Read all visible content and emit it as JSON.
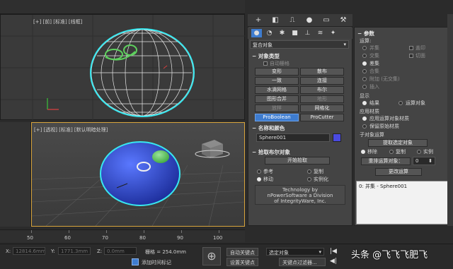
{
  "viewports": {
    "top": {
      "label": "[+] [前] [标准] [线框]"
    },
    "perspective": {
      "label": "[+] [透视] [标准] [默认明暗处理]"
    }
  },
  "command_panel": {
    "tabs": [
      {
        "icon": "plus-icon",
        "glyph": "+"
      },
      {
        "icon": "modify-icon",
        "glyph": "◧"
      },
      {
        "icon": "hierarchy-icon",
        "glyph": "⎍"
      },
      {
        "icon": "motion-icon",
        "glyph": "●"
      },
      {
        "icon": "display-icon",
        "glyph": "▭"
      },
      {
        "icon": "utilities-icon",
        "glyph": "⚒"
      }
    ],
    "category_icons": [
      {
        "icon": "geometry-icon",
        "glyph": "●"
      },
      {
        "icon": "shapes-icon",
        "glyph": "◔"
      },
      {
        "icon": "lights-icon",
        "glyph": "✱"
      },
      {
        "icon": "cameras-icon",
        "glyph": "■"
      },
      {
        "icon": "helpers-icon",
        "glyph": "⊥"
      },
      {
        "icon": "spacewarps-icon",
        "glyph": "≋"
      },
      {
        "icon": "systems-icon",
        "glyph": "✦"
      }
    ],
    "dropdown_value": "复合对象",
    "object_type": {
      "header": "对象类型",
      "autogrid": "自动栅格",
      "buttons": [
        {
          "label": "变形",
          "state": "normal"
        },
        {
          "label": "散布",
          "state": "normal"
        },
        {
          "label": "一致",
          "state": "normal"
        },
        {
          "label": "连接",
          "state": "normal"
        },
        {
          "label": "水滴网格",
          "state": "normal"
        },
        {
          "label": "布尔",
          "state": "normal"
        },
        {
          "label": "图形合并",
          "state": "normal"
        },
        {
          "label": "地形",
          "state": "dim"
        },
        {
          "label": "放样",
          "state": "dim"
        },
        {
          "label": "网格化",
          "state": "normal"
        },
        {
          "label": "ProBoolean",
          "state": "active"
        },
        {
          "label": "ProCutter",
          "state": "normal"
        }
      ]
    },
    "name_color": {
      "header": "名称和颜色",
      "name": "Sphere001",
      "color": "#4a4ae0"
    },
    "pick_boolean": {
      "header": "拾取布尔对象",
      "start_pick": "开始拾取",
      "options": [
        {
          "label": "参考",
          "on": false
        },
        {
          "label": "复制",
          "on": false
        },
        {
          "label": "移动",
          "on": true
        },
        {
          "label": "实例化",
          "on": false
        }
      ],
      "credit": [
        "Technology by",
        "nPowerSoftware a Division",
        "of IntegrityWare, Inc."
      ]
    }
  },
  "parameters": {
    "header": "参数",
    "operation_label": "运算:",
    "operations": [
      {
        "label": "并集",
        "on": false
      },
      {
        "label": "交集",
        "on": false
      },
      {
        "label": "差集",
        "on": true
      },
      {
        "label": "合集",
        "on": false
      },
      {
        "label": "附加 (无交集)",
        "on": false
      },
      {
        "label": "插入",
        "on": false
      }
    ],
    "ops_right": [
      "盖印",
      "切面"
    ],
    "display_label": "显示",
    "display_opts": [
      {
        "label": "结果",
        "on": true
      },
      {
        "label": "运算对象",
        "on": false
      }
    ],
    "apply_material_label": "应用材质",
    "apply_material": [
      {
        "label": "应用运算对象材质",
        "on": true
      },
      {
        "label": "保留原始材质",
        "on": false
      }
    ],
    "subobject_label": "子对象运算",
    "extract_selected": "提取选定对象",
    "sub_opts": [
      {
        "label": "移除",
        "on": true
      },
      {
        "label": "复制",
        "on": false
      },
      {
        "label": "实例",
        "on": false
      }
    ],
    "reorder_label": "重排运算对象：",
    "reorder_value": "0",
    "change_op": "更改运算",
    "list_items": [
      "0: 并集 - Sphere001"
    ]
  },
  "ruler": {
    "ticks": [
      "50",
      "60",
      "70",
      "80",
      "90",
      "100"
    ]
  },
  "status": {
    "x_label": "X:",
    "x_value": "12814.6mm",
    "y_label": "Y:",
    "y_value": "1771.3mm",
    "z_label": "Z:",
    "z_value": "0.0mm",
    "grid": "栅格 = 254.0mm",
    "add_time_tag": "添加时间标记",
    "auto_key": "自动关键点",
    "set_key": "设置关键点",
    "selected_object": "选定对象",
    "key_filters": "关键点过滤器..."
  },
  "watermark": "头条 @飞飞飞肥飞",
  "colors": {
    "selection_cyan": "#38e8f0",
    "sphere_blue": "#2f4fd0",
    "active_button": "#3e7ccf",
    "viewport_border_active": "#d8a43c"
  }
}
